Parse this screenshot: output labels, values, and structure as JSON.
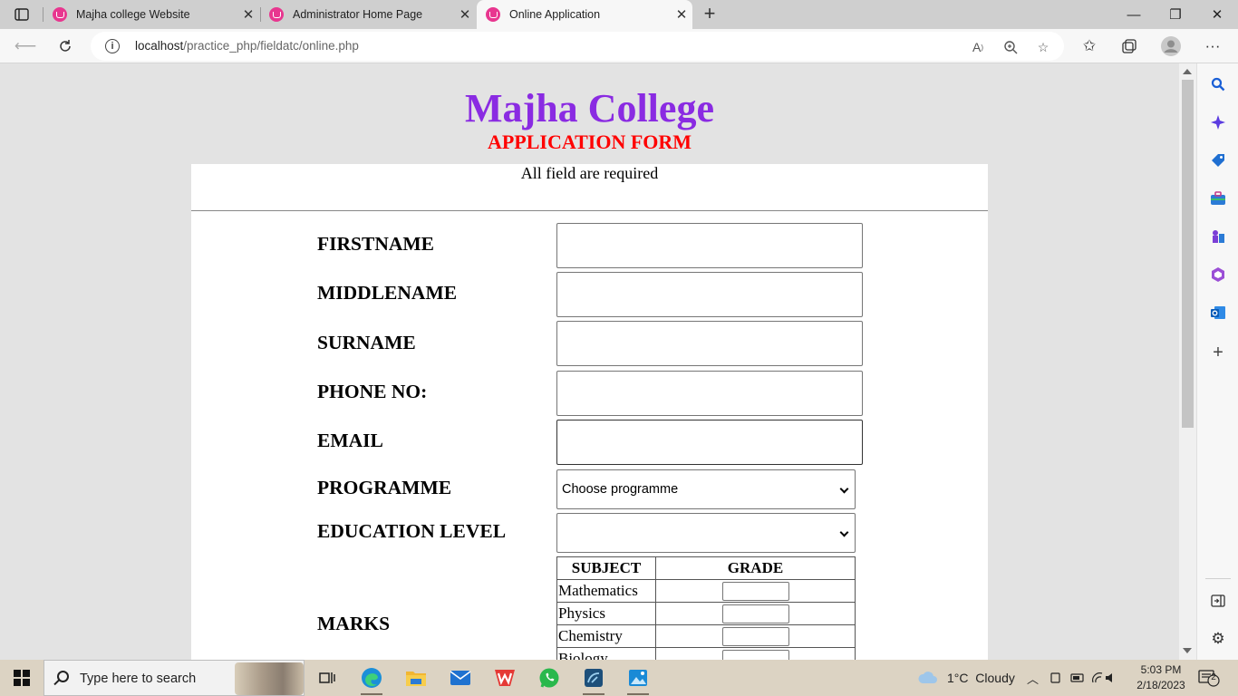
{
  "browser": {
    "tabs": [
      {
        "title": "Majha college Website"
      },
      {
        "title": "Administrator Home Page"
      },
      {
        "title": "Online Application",
        "active": true
      }
    ],
    "url": {
      "host": "localhost",
      "path": "/practice_php/fieldatc/online.php"
    }
  },
  "page": {
    "college_name": "Majha College",
    "form_title": "APPLICATION FORM",
    "required_note": "All field are required",
    "fields": [
      {
        "label": "FIRSTNAME",
        "value": ""
      },
      {
        "label": "MIDDLENAME",
        "value": ""
      },
      {
        "label": "SURNAME",
        "value": ""
      },
      {
        "label": "PHONE NO:",
        "value": ""
      },
      {
        "label": "EMAIL",
        "value": ""
      }
    ],
    "programme": {
      "label": "PROGRAMME",
      "selected": "Choose programme"
    },
    "education_level": {
      "label": "EDUCATION LEVEL",
      "selected": ""
    },
    "marks": {
      "label": "MARKS",
      "headers": [
        "SUBJECT",
        "GRADE"
      ],
      "subjects": [
        "Mathematics",
        "Physics",
        "Chemistry",
        "Biology"
      ]
    }
  },
  "taskbar": {
    "search_placeholder": "Type here to search",
    "weather": "1°C  Cloudy",
    "time": "5:03 PM",
    "date": "2/18/2023",
    "notification_count": "2"
  },
  "colors": {
    "college_name": "#8a2be2",
    "form_title": "#ff0000",
    "favicon": "#e8368f"
  }
}
